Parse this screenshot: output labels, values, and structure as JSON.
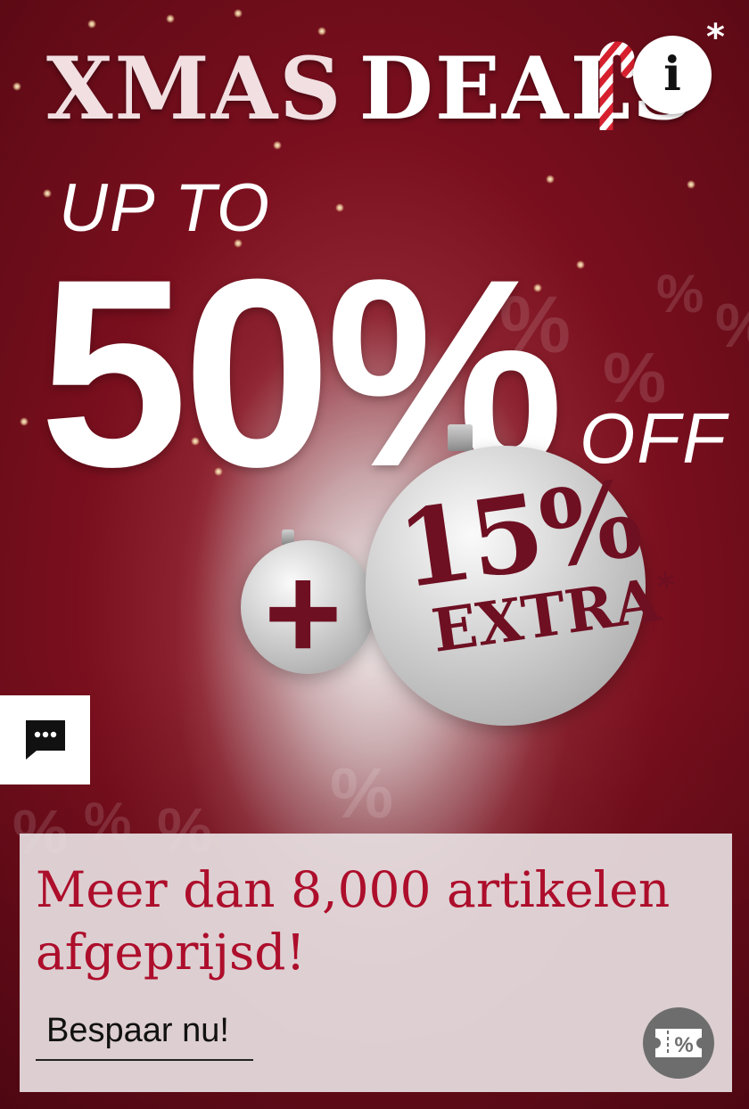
{
  "promo": {
    "title_part1": "XMAS",
    "title_part2": "DEALS",
    "title_asterisk": "*",
    "info_label": "i",
    "upto": "UP TO",
    "discount": "50%",
    "off": "OFF",
    "plus": "+",
    "extra_percent": "15%",
    "extra_label": "EXTRA",
    "extra_asterisk": "*"
  },
  "card": {
    "headline": "Meer dan 8,000 artikelen afgeprijsd!",
    "cta_label": "Bespaar nu!"
  },
  "icons": {
    "info": "info-icon",
    "chat": "chat-bubble-icon",
    "coupon": "coupon-percent-icon"
  },
  "colors": {
    "brand_red": "#ad0e2b",
    "ornament_text": "#6e0f22",
    "background": "#7a0f1e"
  }
}
